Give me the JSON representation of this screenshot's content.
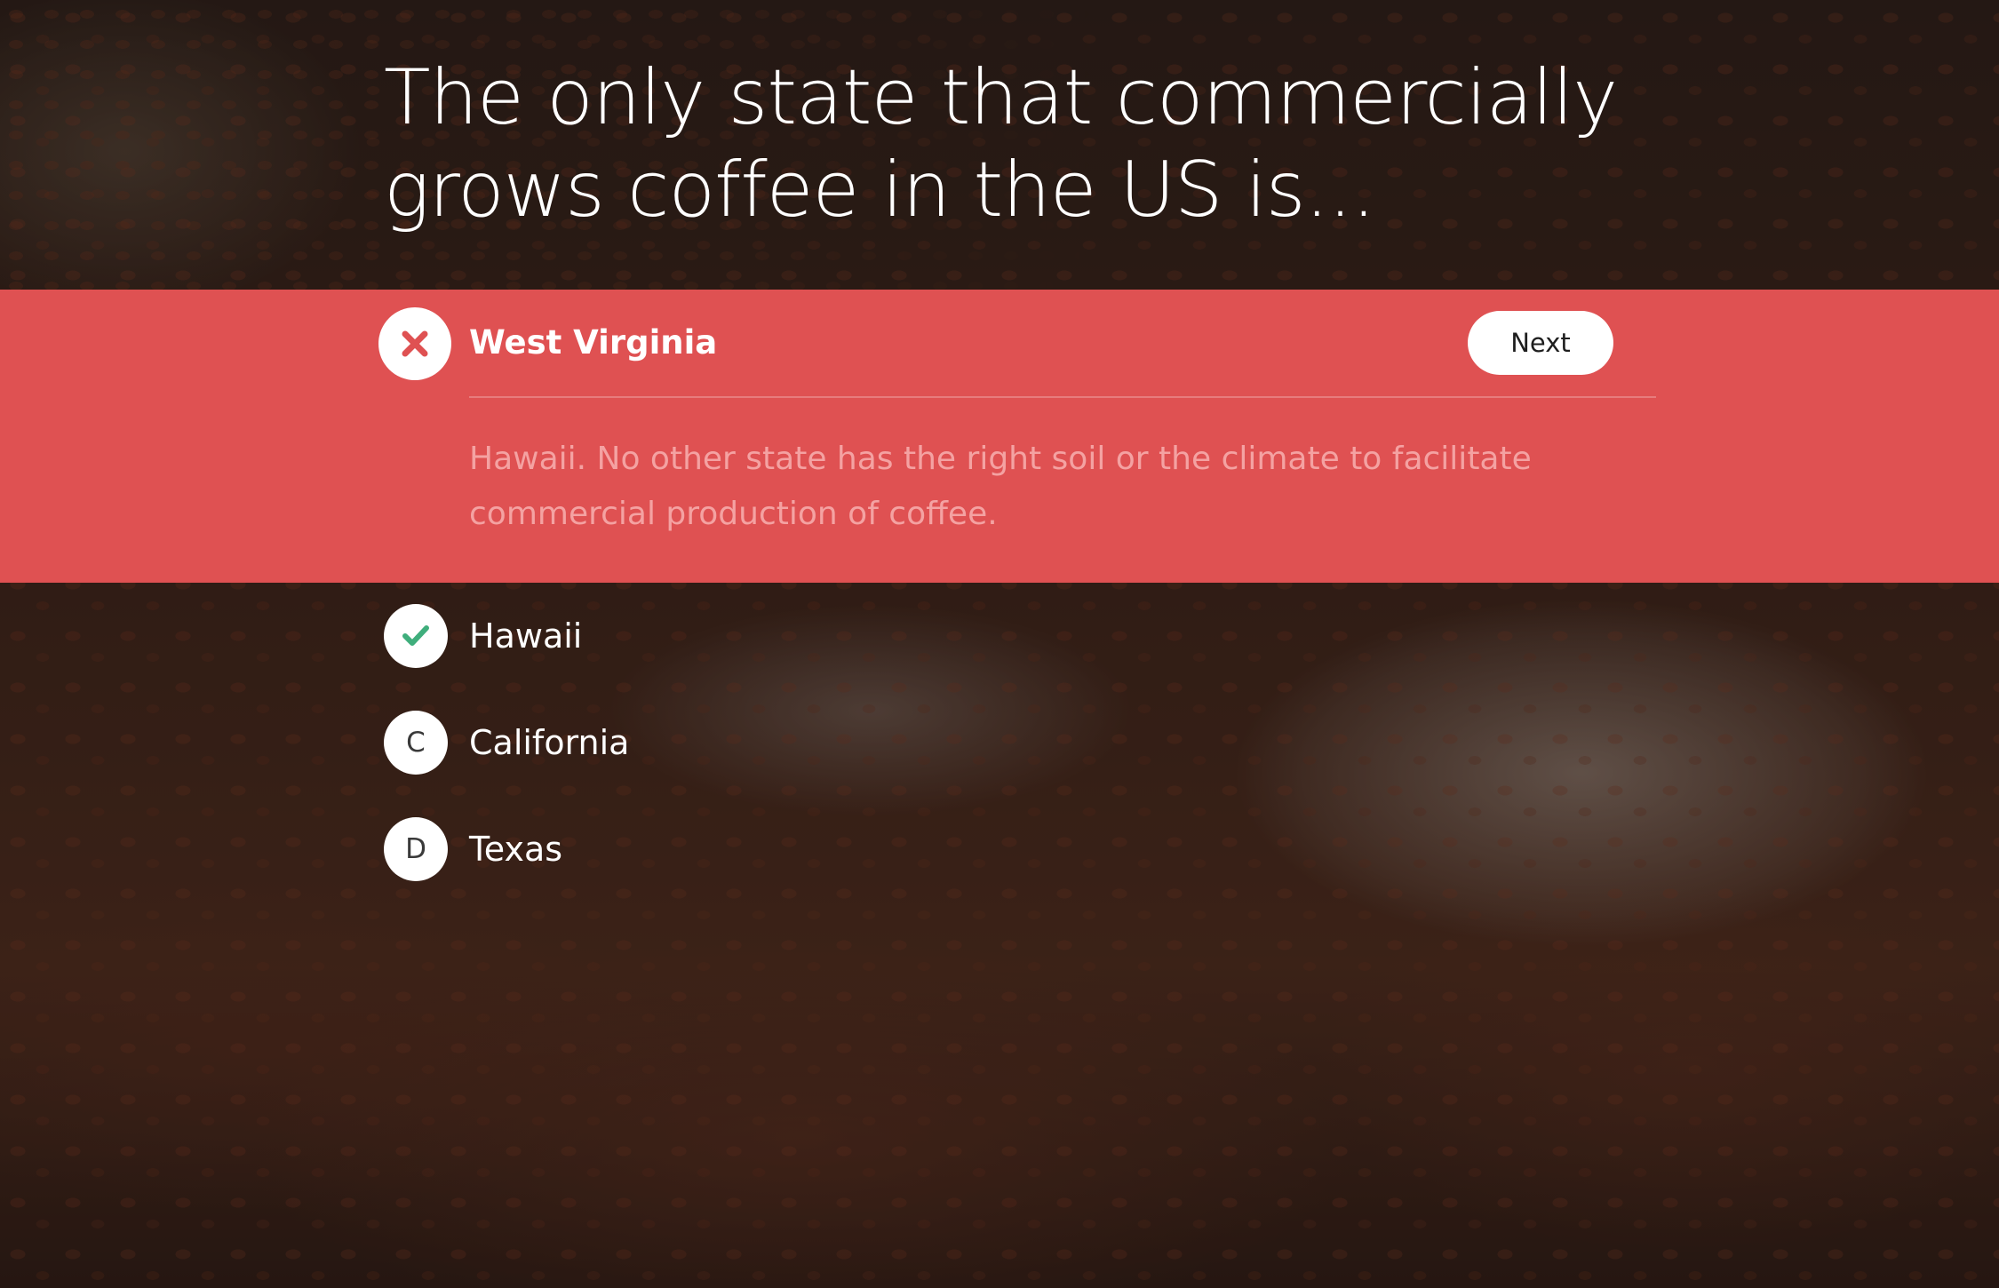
{
  "question": {
    "text": "The only state that commercially grows coffee in the US is..."
  },
  "feedback": {
    "status_icon": "x-mark-icon",
    "selected_answer": "West Virginia",
    "next_label": "Next",
    "explanation": "Hawaii. No other state has the right soil or the climate to facilitate commercial production of coffee.",
    "band_color": "#df5152",
    "explanation_color": "#f4a2a2"
  },
  "options": [
    {
      "marker": "",
      "marker_icon": "checkmark-icon",
      "label": "Hawaii",
      "correct": true,
      "marker_color": "#3fae7c"
    },
    {
      "marker": "C",
      "label": "California"
    },
    {
      "marker": "D",
      "label": "Texas"
    }
  ]
}
